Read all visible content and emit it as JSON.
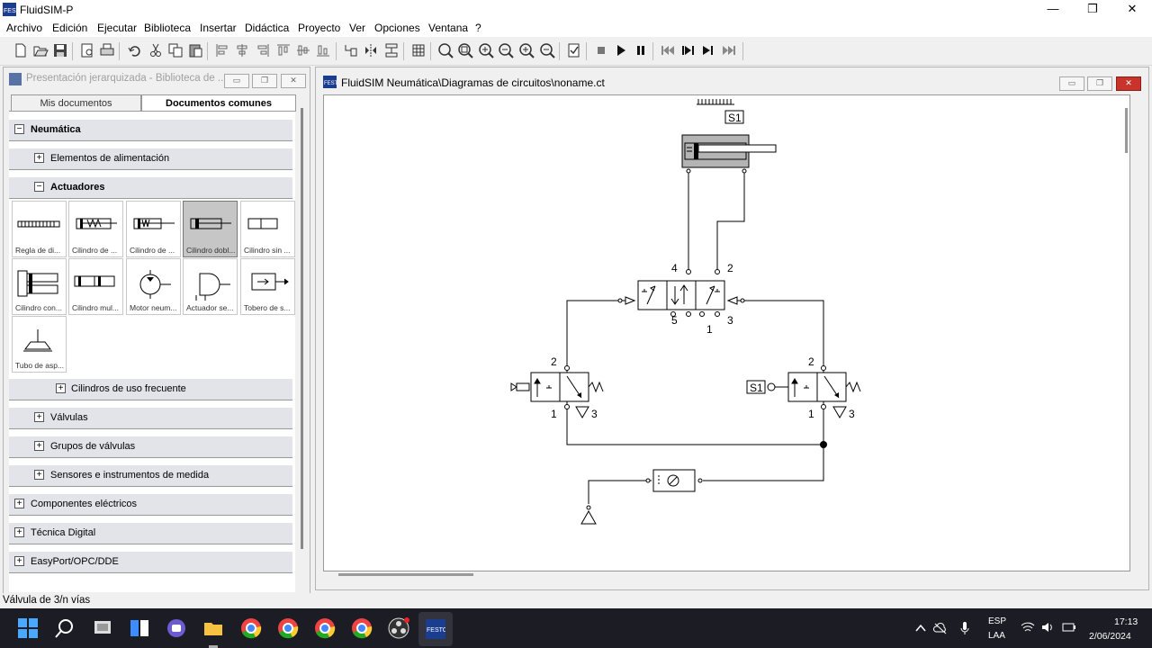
{
  "app": {
    "title": "FluidSIM-P"
  },
  "window_buttons": {
    "minimize": "—",
    "maximize": "❐",
    "close": "✕"
  },
  "menu": [
    "Archivo",
    "Edición",
    "Ejecutar",
    "Biblioteca",
    "Insertar",
    "Didáctica",
    "Proyecto",
    "Ver",
    "Opciones",
    "Ventana",
    "?"
  ],
  "toolbar_icons": [
    "new-icon",
    "open-icon",
    "save-icon",
    "print-preview-icon",
    "print-icon",
    "undo-icon",
    "cut-icon",
    "copy-icon",
    "paste-icon",
    "align-left-icon",
    "align-center-icon",
    "align-right-icon",
    "align-top-icon",
    "align-middle-icon",
    "align-bottom-icon",
    "rotate-icon",
    "flip-icon",
    "group-icon",
    "grid-icon",
    "zoom-1-icon",
    "zoom-fit-icon",
    "zoom-window-icon",
    "zoom-previous-icon",
    "zoom-in-icon",
    "zoom-out-icon",
    "check-icon",
    "stop-icon",
    "play-icon",
    "pause-icon",
    "reset-icon",
    "step-icon",
    "step-forward-icon",
    "fast-forward-icon"
  ],
  "library": {
    "caption": "Presentación jerarquizada - Biblioteca de ...",
    "tabs": [
      "Mis documentos",
      "Documentos comunes"
    ],
    "rows": {
      "neumatica": "Neumática",
      "alimentacion": "Elementos de alimentación",
      "actuadores": "Actuadores",
      "frecuentes": "Cilindros de uso frecuente",
      "valvulas": "Válvulas",
      "grupos": "Grupos de válvulas",
      "sensores": "Sensores e instrumentos de medida",
      "electricos": "Componentes eléctricos",
      "digital": "Técnica Digital",
      "easyport": "EasyPort/OPC/DDE"
    },
    "tiles": [
      "Regla de di...",
      "Cilindro de ...",
      "Cilindro de ...",
      "Cilindro dobl...",
      "Cilindro sin ...",
      "Cilindro con...",
      "Cilindro mul...",
      "Motor neum...",
      "Actuador se...",
      "Tobero de s...",
      "Tubo de asp..."
    ]
  },
  "circuit": {
    "caption": "FluidSIM Neumática\\Diagramas de circuitos\\noname.ct",
    "labels": {
      "s1_top": "S1",
      "s1_right": "S1",
      "port4": "4",
      "port2": "2",
      "port5": "5",
      "port1": "1",
      "port3": "3",
      "lv_2": "2",
      "lv_1": "1",
      "lv_3": "3",
      "rv_2": "2",
      "rv_1": "1",
      "rv_3": "3"
    }
  },
  "status": "Válvula de 3/n vías",
  "tray": {
    "lang1": "ESP",
    "lang2": "LAA",
    "time": "17:13",
    "date": "2/06/2024"
  },
  "colors": {
    "accent": "#0078d7",
    "taskbar": "#1c1c24"
  }
}
